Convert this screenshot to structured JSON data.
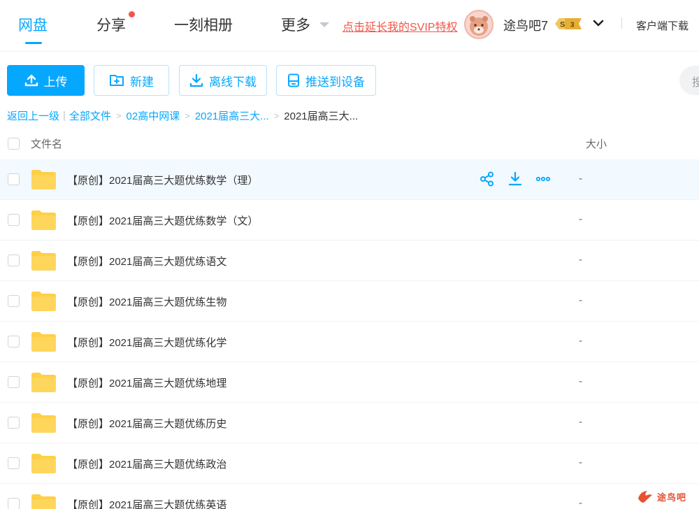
{
  "nav": {
    "tabs": [
      {
        "label": "网盘",
        "active": true
      },
      {
        "label": "分享",
        "has_badge_dot": true
      },
      {
        "label": "一刻相册"
      },
      {
        "label": "更多"
      }
    ],
    "svip_promo": "点击延长我的SVIP特权",
    "username": "途鸟吧7",
    "vip_level_s": "S",
    "vip_level_num": "3",
    "client_download": "客户端下载"
  },
  "toolbar": {
    "upload": "上传",
    "new": "新建",
    "offline_download": "离线下载",
    "push_to_device": "推送到设备",
    "search_hint": "搜"
  },
  "breadcrumb": {
    "back": "返回上一级",
    "all_files": "全部文件",
    "level1": "02高中网课",
    "level2": "2021届高三大...",
    "current": "2021届高三大..."
  },
  "list": {
    "col_name": "文件名",
    "col_size": "大小",
    "rows": [
      {
        "name": "【原创】2021届高三大题优练数学（理）",
        "size": "-"
      },
      {
        "name": "【原创】2021届高三大题优练数学（文）",
        "size": "-"
      },
      {
        "name": "【原创】2021届高三大题优练语文",
        "size": "-"
      },
      {
        "name": "【原创】2021届高三大题优练生物",
        "size": "-"
      },
      {
        "name": "【原创】2021届高三大题优练化学",
        "size": "-"
      },
      {
        "name": "【原创】2021届高三大题优练地理",
        "size": "-"
      },
      {
        "name": "【原创】2021届高三大题优练历史",
        "size": "-"
      },
      {
        "name": "【原创】2021届高三大题优练政治",
        "size": "-"
      },
      {
        "name": "【原创】2021届高三大题优练英语",
        "size": "-"
      }
    ]
  },
  "watermark": {
    "text": "途鸟吧"
  },
  "colors": {
    "accent": "#06a7ff",
    "promo_red": "#f2564a",
    "folder_yellow": "#ffcf45",
    "row_hover": "#f2f9ff"
  },
  "icons": {
    "upload": "upload-icon",
    "new": "new-folder-icon",
    "offline_download": "download-icon",
    "push": "device-icon",
    "row_share": "share-icon",
    "row_download": "download-icon",
    "row_more": "more-icon",
    "folder": "folder-icon"
  }
}
